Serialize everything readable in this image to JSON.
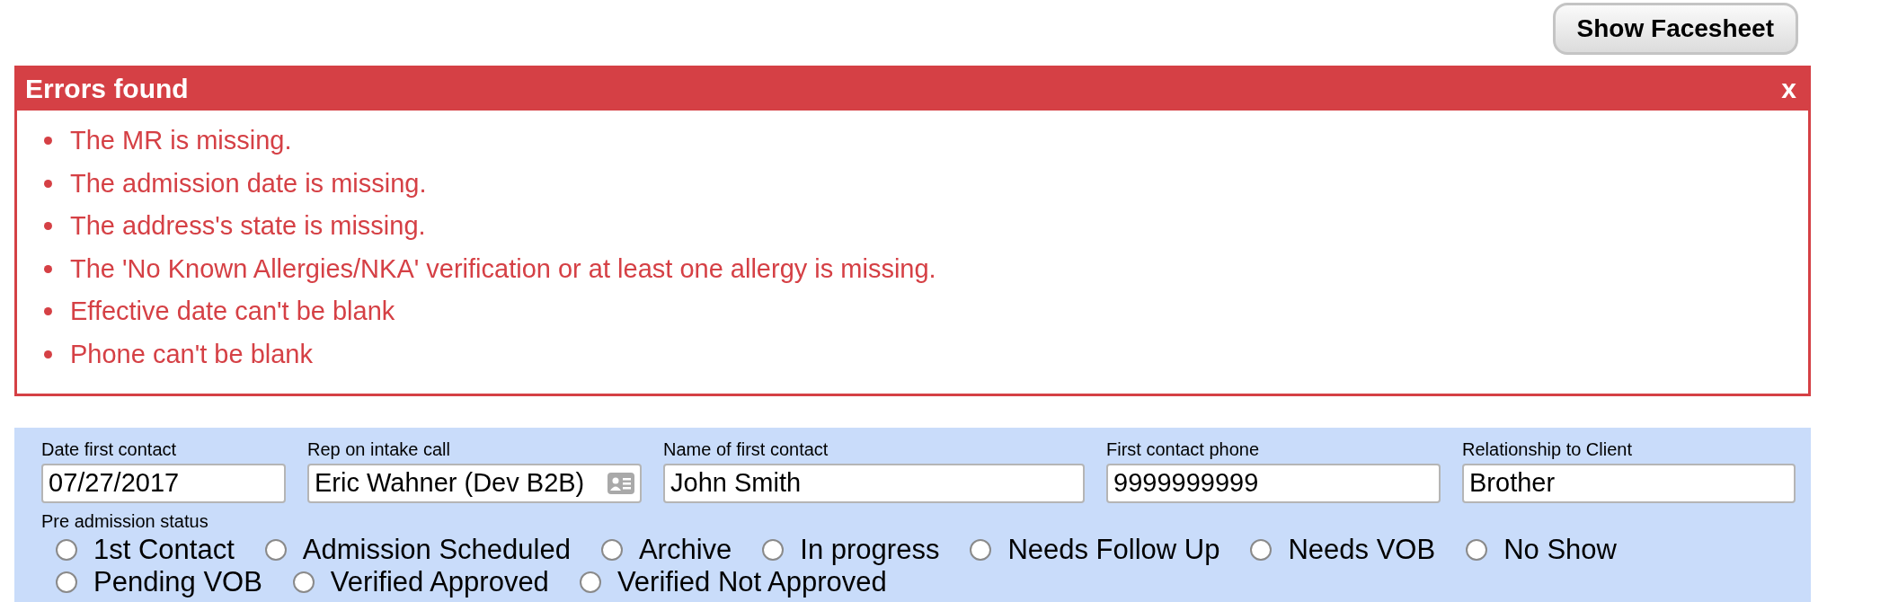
{
  "toolbar": {
    "button": "Show Facesheet"
  },
  "errors": {
    "title": "Errors found",
    "close": "x",
    "items": [
      "The MR is missing.",
      "The admission date is missing.",
      "The address's state is missing.",
      "The 'No Known Allergies/NKA' verification or at least one allergy is missing.",
      "Effective date can't be blank",
      "Phone can't be blank"
    ]
  },
  "form": {
    "fields": [
      {
        "label": "Date first contact",
        "value": "07/27/2017",
        "kind": "text"
      },
      {
        "label": "Rep on intake call",
        "value": "Eric Wahner (Dev B2B)",
        "kind": "contact"
      },
      {
        "label": "Name of first contact",
        "value": "John Smith",
        "kind": "text"
      },
      {
        "label": "First contact phone",
        "value": "9999999999",
        "kind": "text"
      },
      {
        "label": "Relationship to Client",
        "value": "Brother",
        "kind": "text"
      }
    ],
    "status": {
      "label": "Pre admission status",
      "options": [
        {
          "label": "1st Contact",
          "selected": false
        },
        {
          "label": "Admission Scheduled",
          "selected": false
        },
        {
          "label": "Archive",
          "selected": false
        },
        {
          "label": "In progress",
          "selected": false
        },
        {
          "label": "Needs Follow Up",
          "selected": false
        },
        {
          "label": "Needs VOB",
          "selected": false
        },
        {
          "label": "No Show",
          "selected": false
        },
        {
          "label": "Pending VOB",
          "selected": false
        },
        {
          "label": "Verified Approved",
          "selected": false
        },
        {
          "label": "Verified Not Approved",
          "selected": false
        }
      ]
    }
  }
}
